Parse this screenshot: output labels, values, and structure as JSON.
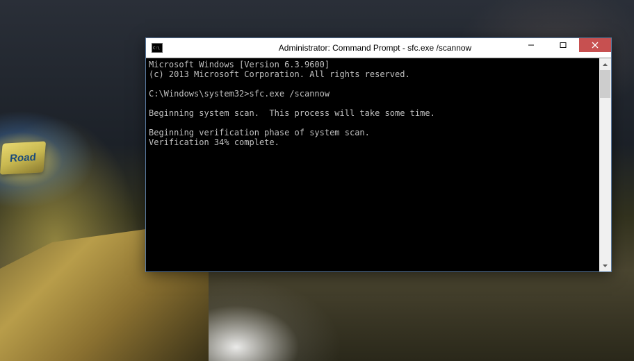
{
  "wallpaper": {
    "sign_text": "Road"
  },
  "window": {
    "title": "Administrator: Command Prompt - sfc.exe  /scannow",
    "icon_name": "cmd-icon"
  },
  "controls": {
    "minimize": "—",
    "maximize": "□",
    "close": "✕"
  },
  "console": {
    "lines": [
      "Microsoft Windows [Version 6.3.9600]",
      "(c) 2013 Microsoft Corporation. All rights reserved.",
      "",
      "C:\\Windows\\system32>sfc.exe /scannow",
      "",
      "Beginning system scan.  This process will take some time.",
      "",
      "Beginning verification phase of system scan.",
      "Verification 34% complete."
    ]
  }
}
